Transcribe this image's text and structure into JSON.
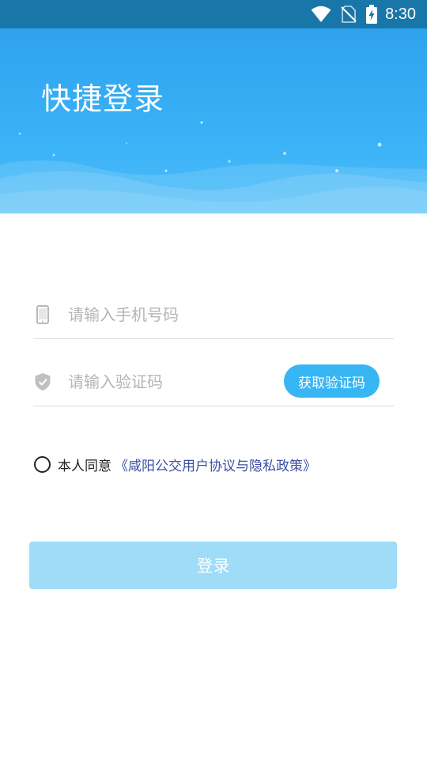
{
  "status_bar": {
    "time": "8:30",
    "icons": [
      "wifi-icon",
      "no-sim-icon",
      "battery-charging-icon"
    ]
  },
  "header": {
    "title": "快捷登录"
  },
  "form": {
    "phone": {
      "icon": "phone-icon",
      "value": "",
      "placeholder": "请输入手机号码"
    },
    "code": {
      "icon": "shield-check-icon",
      "value": "",
      "placeholder": "请输入验证码",
      "get_code_label": "获取验证码"
    },
    "agreement": {
      "checked": false,
      "text": "本人同意",
      "link_text": "《咸阳公交用户协议与隐私政策》"
    },
    "login_label": "登录"
  },
  "colors": {
    "status_bar": "#1976a8",
    "header_gradient_top": "#2fa2ee",
    "header_gradient_bottom": "#4cbdf9",
    "accent": "#38b5f3",
    "login_disabled": "#9edcf8",
    "link": "#3b4ea5"
  }
}
